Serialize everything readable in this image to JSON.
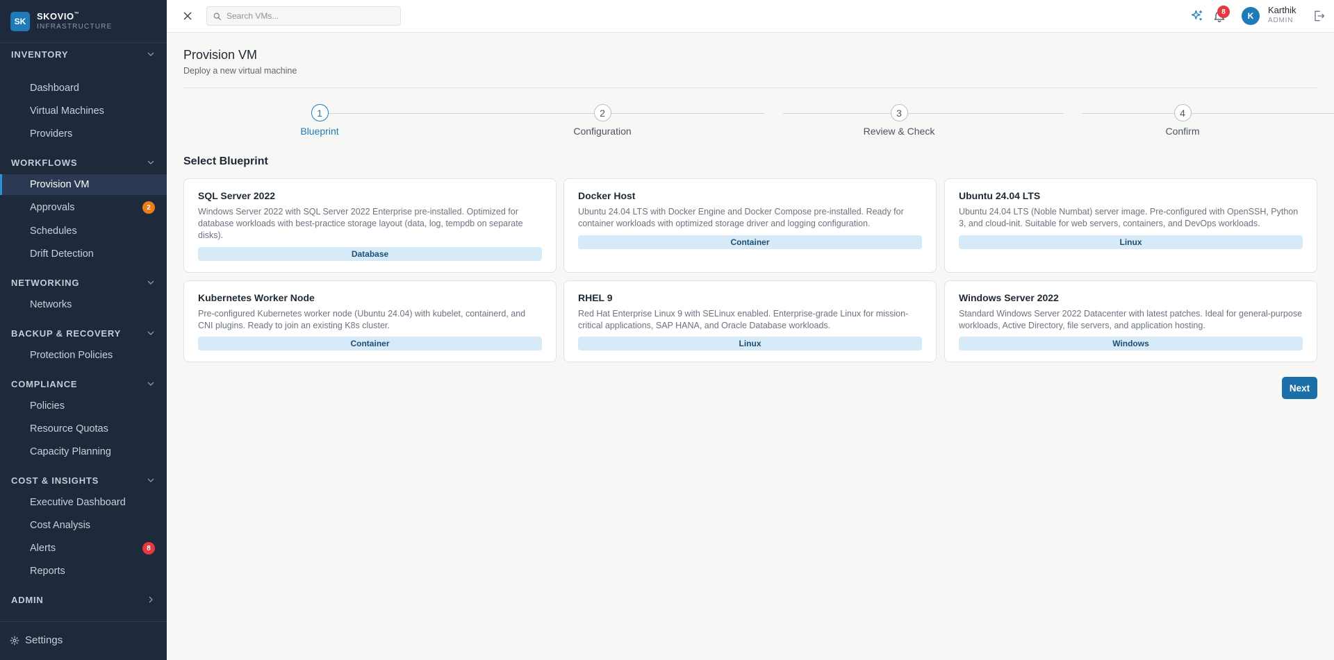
{
  "brand": {
    "logo": "SK",
    "name": "SKOVIO",
    "tm": "™",
    "subtitle": "INFRASTRUCTURE"
  },
  "sidebar": {
    "sections": [
      {
        "title": "INVENTORY",
        "items": [
          {
            "label": "Dashboard"
          },
          {
            "label": "Virtual Machines"
          },
          {
            "label": "Providers"
          }
        ]
      },
      {
        "title": "WORKFLOWS",
        "items": [
          {
            "label": "Provision VM",
            "active": true
          },
          {
            "label": "Approvals",
            "badge": "2"
          },
          {
            "label": "Schedules"
          },
          {
            "label": "Drift Detection"
          }
        ]
      },
      {
        "title": "NETWORKING",
        "items": [
          {
            "label": "Networks"
          }
        ]
      },
      {
        "title": "BACKUP & RECOVERY",
        "items": [
          {
            "label": "Protection Policies"
          }
        ]
      },
      {
        "title": "COMPLIANCE",
        "items": [
          {
            "label": "Policies"
          },
          {
            "label": "Resource Quotas"
          },
          {
            "label": "Capacity Planning"
          }
        ]
      },
      {
        "title": "COST & INSIGHTS",
        "items": [
          {
            "label": "Executive Dashboard"
          },
          {
            "label": "Cost Analysis"
          },
          {
            "label": "Alerts",
            "badge": "8"
          },
          {
            "label": "Reports"
          }
        ]
      },
      {
        "title": "ADMIN",
        "items": []
      }
    ],
    "settings_label": "Settings"
  },
  "topbar": {
    "search_placeholder": "Search VMs...",
    "notification_count": "8",
    "user_initial": "K",
    "user_name": "Karthik",
    "user_role": "ADMIN"
  },
  "page": {
    "title": "Provision VM",
    "subtitle": "Deploy a new virtual machine",
    "steps": [
      {
        "number": "1",
        "label": "Blueprint",
        "active": true
      },
      {
        "number": "2",
        "label": "Configuration"
      },
      {
        "number": "3",
        "label": "Review & Check"
      },
      {
        "number": "4",
        "label": "Confirm"
      }
    ],
    "section_title": "Select Blueprint",
    "blueprints": [
      {
        "name": "SQL Server 2022",
        "description": "Windows Server 2022 with SQL Server 2022 Enterprise pre-installed. Optimized for database workloads with best-practice storage layout (data, log, tempdb on separate disks).",
        "tag": "Database"
      },
      {
        "name": "Docker Host",
        "description": "Ubuntu 24.04 LTS with Docker Engine and Docker Compose pre-installed. Ready for container workloads with optimized storage driver and logging configuration.",
        "tag": "Container"
      },
      {
        "name": "Ubuntu 24.04 LTS",
        "description": "Ubuntu 24.04 LTS (Noble Numbat) server image. Pre-configured with OpenSSH, Python 3, and cloud-init. Suitable for web servers, containers, and DevOps workloads.",
        "tag": "Linux"
      },
      {
        "name": "Kubernetes Worker Node",
        "description": "Pre-configured Kubernetes worker node (Ubuntu 24.04) with kubelet, containerd, and CNI plugins. Ready to join an existing K8s cluster.",
        "tag": "Container"
      },
      {
        "name": "RHEL 9",
        "description": "Red Hat Enterprise Linux 9 with SELinux enabled. Enterprise-grade Linux for mission-critical applications, SAP HANA, and Oracle Database workloads.",
        "tag": "Linux"
      },
      {
        "name": "Windows Server 2022",
        "description": "Standard Windows Server 2022 Datacenter with latest patches. Ideal for general-purpose workloads, Active Directory, file servers, and application hosting.",
        "tag": "Windows"
      }
    ],
    "next_label": "Next"
  },
  "colors": {
    "sidebar_bg": "#1e2a3b",
    "accent": "#1f7ab8",
    "badge_orange": "#ef7d17",
    "badge_red": "#e5393f",
    "tag_bg": "#d6eaf7"
  }
}
